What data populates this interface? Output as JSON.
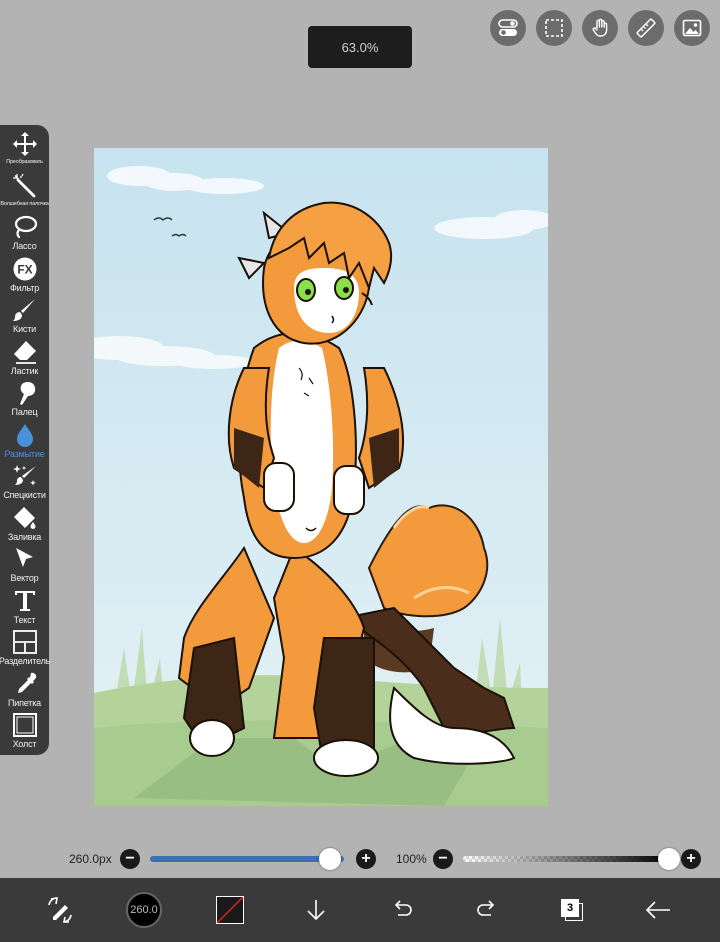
{
  "zoom": {
    "label": "63.0%"
  },
  "top_toolbar": {
    "icons": [
      "toggle-icon",
      "selection-icon",
      "hand-icon",
      "ruler-icon",
      "gallery-icon"
    ]
  },
  "tools": [
    {
      "name": "transform",
      "label": "Преобразовать",
      "icon": "move-icon"
    },
    {
      "name": "magic-wand",
      "label": "Волшебная палочка",
      "icon": "magic-wand-icon"
    },
    {
      "name": "lasso",
      "label": "Лассо",
      "icon": "lasso-icon"
    },
    {
      "name": "filter",
      "label": "Фильтр",
      "icon": "fx-icon"
    },
    {
      "name": "brush",
      "label": "Кисти",
      "icon": "brush-icon"
    },
    {
      "name": "eraser",
      "label": "Ластик",
      "icon": "eraser-icon"
    },
    {
      "name": "smudge",
      "label": "Палец",
      "icon": "smudge-icon"
    },
    {
      "name": "blur",
      "label": "Размытие",
      "icon": "drop-icon",
      "active": true
    },
    {
      "name": "special-brush",
      "label": "Спецкисти",
      "icon": "sparkle-brush-icon"
    },
    {
      "name": "fill",
      "label": "Заливка",
      "icon": "fill-icon"
    },
    {
      "name": "vector",
      "label": "Вектор",
      "icon": "cursor-icon"
    },
    {
      "name": "text",
      "label": "Текст",
      "icon": "text-icon"
    },
    {
      "name": "divider",
      "label": "Разделитель",
      "icon": "frame-divider-icon"
    },
    {
      "name": "eyedropper",
      "label": "Пипетка",
      "icon": "eyedropper-icon"
    },
    {
      "name": "canvas",
      "label": "Холст",
      "icon": "canvas-icon"
    }
  ],
  "brush_size": {
    "value_label": "260.0px",
    "fraction": 0.93
  },
  "opacity": {
    "value_label": "100%",
    "fraction": 1.0
  },
  "bottom_bar": {
    "brush_preview_label": "260.0",
    "layers_count": "3",
    "items": [
      "brush-mode-icon",
      "brush-size-preview",
      "color-swatch",
      "import-down-icon",
      "undo-icon",
      "redo-icon",
      "layers-icon",
      "back-arrow-icon"
    ]
  },
  "colors": {
    "accent": "#4a90d9",
    "toolbar": "#3a3a3a",
    "workspace": "#b3b3b3",
    "size_track": "#3f6fb0",
    "current_color": "#1a1a1a"
  }
}
